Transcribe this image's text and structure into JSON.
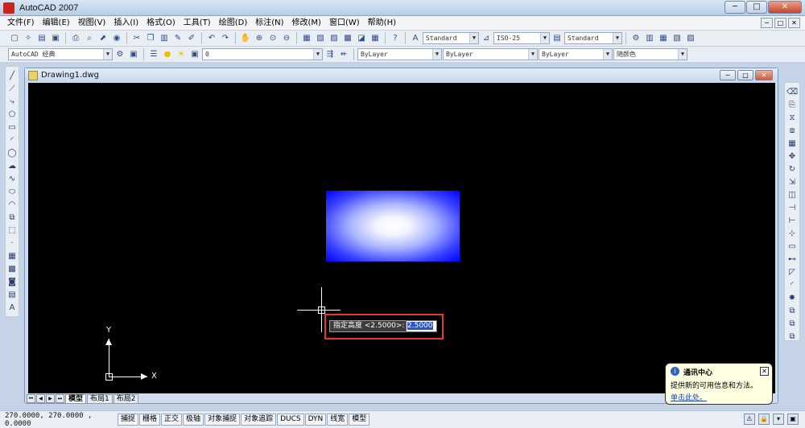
{
  "app": {
    "title": "AutoCAD 2007"
  },
  "window_buttons": {
    "min": "─",
    "max": "□",
    "close": "✕"
  },
  "menu": [
    "文件(F)",
    "编辑(E)",
    "视图(V)",
    "插入(I)",
    "格式(O)",
    "工具(T)",
    "绘图(D)",
    "标注(N)",
    "修改(M)",
    "窗口(W)",
    "帮助(H)"
  ],
  "toolbar": {
    "text_style": "Standard",
    "dim_style": "ISO-25",
    "table_style": "Standard",
    "workspace": "AutoCAD 经典",
    "layer": "0",
    "color": "ByLayer",
    "linetype": "ByLayer",
    "lineweight": "ByLayer",
    "plot_style": "随颜色"
  },
  "document": {
    "title": "Drawing1.dwg"
  },
  "dynamic_input": {
    "prompt": "指定高度 <2.5000>:",
    "value": "2.5000"
  },
  "ucs": {
    "x_label": "X",
    "y_label": "Y"
  },
  "layout_tabs": {
    "model": "模型",
    "layout1": "布局1",
    "layout2": "布局2"
  },
  "status": {
    "coordinates": "270.0000,  270.0000 , 0.0000",
    "buttons": [
      "捕捉",
      "栅格",
      "正交",
      "极轴",
      "对象捕捉",
      "对象追踪",
      "DUCS",
      "DYN",
      "线宽",
      "模型"
    ]
  },
  "balloon": {
    "title": "通讯中心",
    "text": "提供新的可用信息和方法。",
    "link": "单击此处。"
  },
  "colors": {
    "canvas_bg": "#000000",
    "gradient_edge": "#0000ff",
    "gradient_center": "#ffffff",
    "highlight_border": "#e23a2c"
  }
}
